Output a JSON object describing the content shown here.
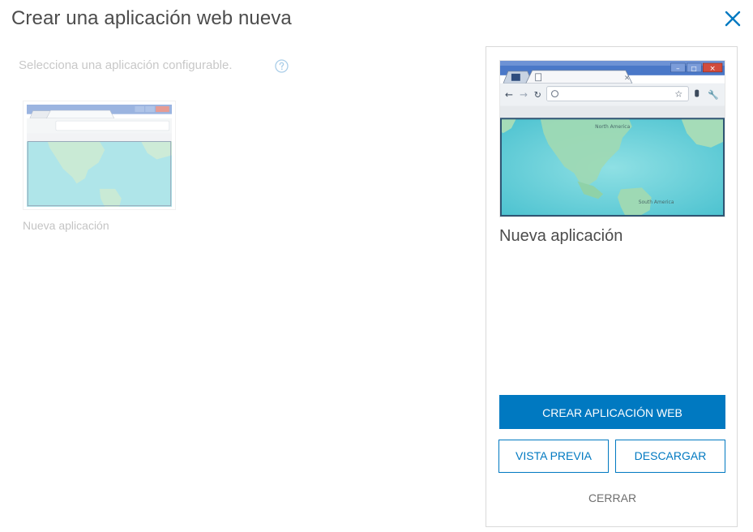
{
  "dialog": {
    "title": "Crear una aplicación web nueva",
    "close_icon": "close-icon"
  },
  "gallery": {
    "subtitle": "Selecciona una aplicación configurable.",
    "help_icon": "question-circle-icon",
    "items": [
      {
        "label": "Nueva aplicación",
        "thumbnail": "browser-map-thumbnail"
      }
    ]
  },
  "detail_panel": {
    "title": "Nueva aplicación",
    "preview": "browser-map-thumbnail",
    "map_labels": [
      "North America",
      "South America"
    ],
    "create_label": "CREAR APLICACIÓN WEB",
    "preview_label": "VISTA PREVIA",
    "download_label": "DESCARGAR",
    "close_label": "CERRAR"
  },
  "colors": {
    "accent": "#0079c1",
    "title_text": "#4c4c4c",
    "muted_text": "#c8c8c8",
    "browser_chrome": "#4a78c8",
    "ocean": "#6fd0d8"
  }
}
